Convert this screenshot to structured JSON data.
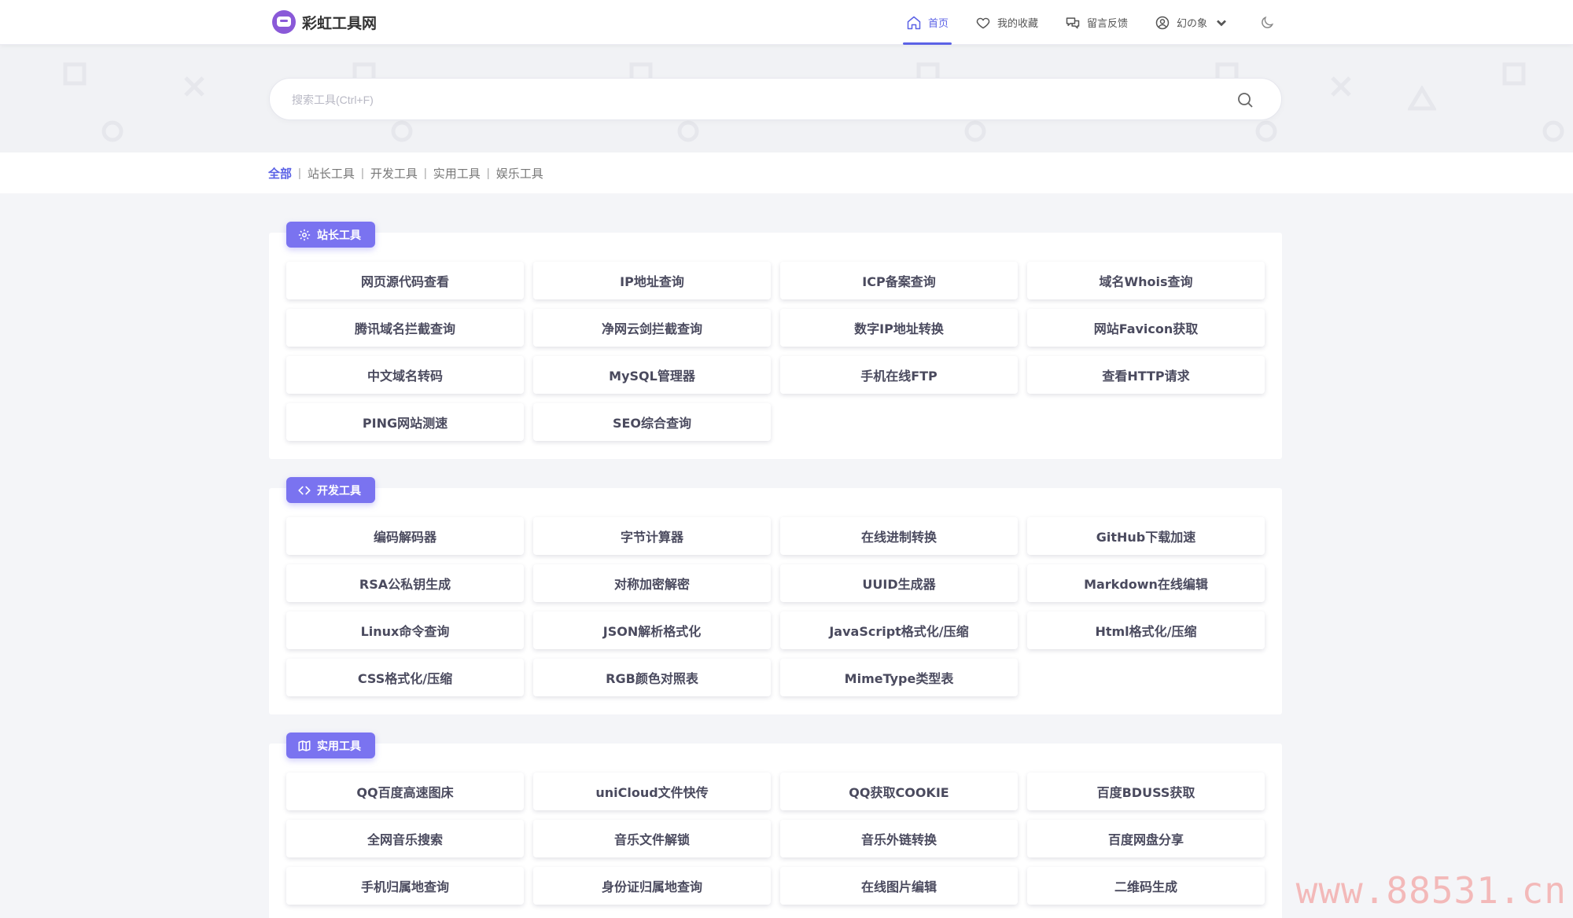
{
  "brand": {
    "name": "彩虹工具网"
  },
  "nav": [
    {
      "label": "首页",
      "icon": "home-icon",
      "active": true
    },
    {
      "label": "我的收藏",
      "icon": "heart-icon",
      "active": false
    },
    {
      "label": "留言反馈",
      "icon": "chat-icon",
      "active": false
    },
    {
      "label": "幻の象",
      "icon": "user-icon",
      "active": false
    }
  ],
  "search": {
    "placeholder": "搜索工具(Ctrl+F)"
  },
  "filters": [
    "全部",
    "站长工具",
    "开发工具",
    "实用工具",
    "娱乐工具"
  ],
  "sections": [
    {
      "title": "站长工具",
      "icon": "gear-icon",
      "tools": [
        "网页源代码查看",
        "IP地址查询",
        "ICP备案查询",
        "域名Whois查询",
        "腾讯域名拦截查询",
        "净网云剑拦截查询",
        "数字IP地址转换",
        "网站Favicon获取",
        "中文域名转码",
        "MySQL管理器",
        "手机在线FTP",
        "查看HTTP请求",
        "PING网站测速",
        "SEO综合查询"
      ]
    },
    {
      "title": "开发工具",
      "icon": "code-icon",
      "tools": [
        "编码解码器",
        "字节计算器",
        "在线进制转换",
        "GitHub下载加速",
        "RSA公私钥生成",
        "对称加密解密",
        "UUID生成器",
        "Markdown在线编辑",
        "Linux命令查询",
        "JSON解析格式化",
        "JavaScript格式化/压缩",
        "Html格式化/压缩",
        "CSS格式化/压缩",
        "RGB颜色对照表",
        "MimeType类型表"
      ]
    },
    {
      "title": "实用工具",
      "icon": "map-icon",
      "tools": [
        "QQ百度高速图床",
        "uniCloud文件快传",
        "QQ获取COOKIE",
        "百度BDUSS获取",
        "全网音乐搜索",
        "音乐文件解锁",
        "音乐外链转换",
        "百度网盘分享",
        "手机归属地查询",
        "身份证归属地查询",
        "在线图片编辑",
        "二维码生成"
      ]
    }
  ],
  "watermark": "www.88531.cn"
}
